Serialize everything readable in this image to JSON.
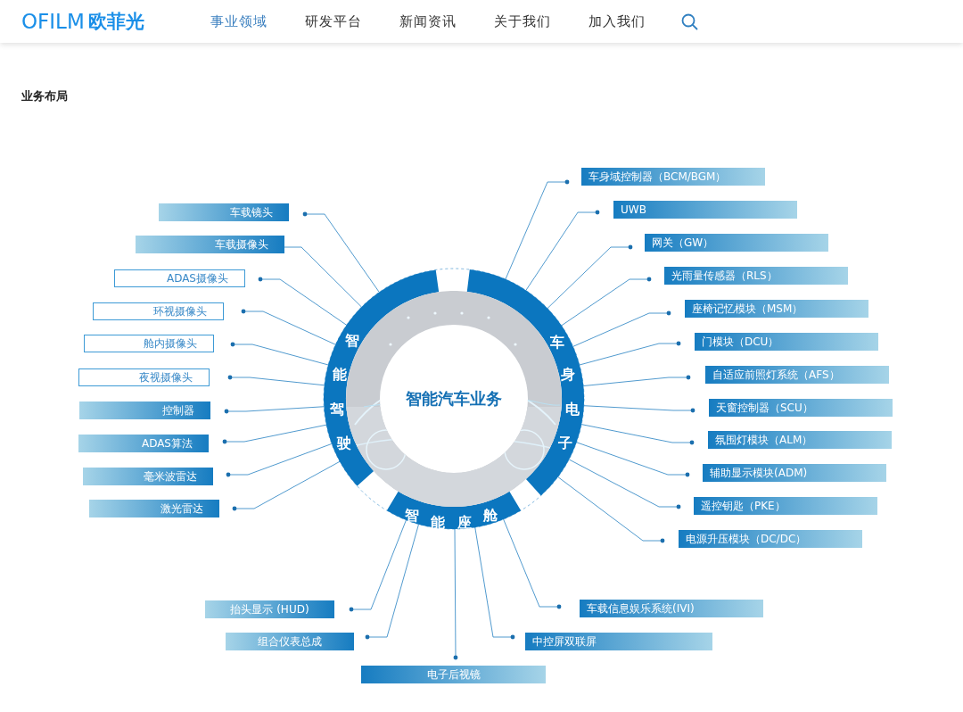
{
  "header": {
    "logo": {
      "latin": "OFILM",
      "cjk": "欧菲光"
    },
    "nav": [
      {
        "label": "事业领域",
        "selected": true
      },
      {
        "label": "研发平台",
        "selected": false
      },
      {
        "label": "新闻资讯",
        "selected": false
      },
      {
        "label": "关于我们",
        "selected": false
      },
      {
        "label": "加入我们",
        "selected": false
      }
    ]
  },
  "section_title": "业务布局",
  "diagram": {
    "center_title": "智能汽车业务",
    "groups": [
      {
        "segment": "智能驾驶",
        "items": [
          {
            "label": "车载镜头",
            "kind": "filled"
          },
          {
            "label": "车载摄像头",
            "kind": "filled"
          },
          {
            "label": "ADAS摄像头",
            "kind": "outlined"
          },
          {
            "label": "环视摄像头",
            "kind": "outlined"
          },
          {
            "label": "舱内摄像头",
            "kind": "outlined"
          },
          {
            "label": "夜视摄像头",
            "kind": "outlined"
          },
          {
            "label": "控制器",
            "kind": "filled"
          },
          {
            "label": "ADAS算法",
            "kind": "filled"
          },
          {
            "label": "毫米波雷达",
            "kind": "filled"
          },
          {
            "label": "激光雷达",
            "kind": "filled"
          }
        ]
      },
      {
        "segment": "车身电子",
        "items": [
          {
            "label": "车身域控制器（BCM/BGM）",
            "kind": "filled"
          },
          {
            "label": "UWB",
            "kind": "filled"
          },
          {
            "label": "网关（GW）",
            "kind": "filled"
          },
          {
            "label": "光雨量传感器（RLS）",
            "kind": "filled"
          },
          {
            "label": "座椅记忆模块（MSM）",
            "kind": "filled"
          },
          {
            "label": "门模块（DCU）",
            "kind": "filled"
          },
          {
            "label": "自适应前照灯系统（AFS）",
            "kind": "filled"
          },
          {
            "label": "天窗控制器（SCU）",
            "kind": "filled"
          },
          {
            "label": "氛围灯模块（ALM）",
            "kind": "filled"
          },
          {
            "label": "辅助显示模块(ADM)",
            "kind": "filled"
          },
          {
            "label": "遥控钥匙（PKE）",
            "kind": "filled"
          },
          {
            "label": "电源升压模块（DC/DC）",
            "kind": "filled"
          }
        ]
      },
      {
        "segment": "智能座舱",
        "items": [
          {
            "label": "抬头显示 (HUD)",
            "kind": "filled"
          },
          {
            "label": "组合仪表总成",
            "kind": "filled"
          },
          {
            "label": "电子后视镜",
            "kind": "filled"
          },
          {
            "label": "中控屏双联屏",
            "kind": "filled"
          },
          {
            "label": "车载信息娱乐系统(IVI)",
            "kind": "filled"
          }
        ]
      }
    ]
  }
}
